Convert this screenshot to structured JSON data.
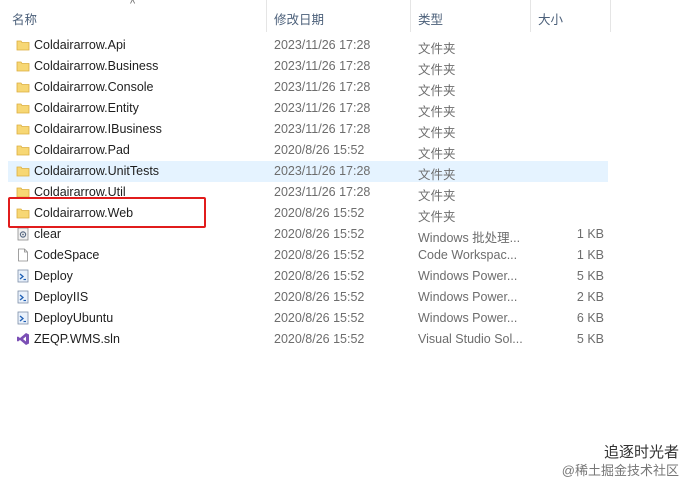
{
  "columns": {
    "name": "名称",
    "date": "修改日期",
    "type": "类型",
    "size": "大小"
  },
  "sort_indicator": "^",
  "files": [
    {
      "name": "Coldairarrow.Api",
      "date": "2023/11/26 17:28",
      "type": "文件夹",
      "size": "",
      "icon": "folder-icon"
    },
    {
      "name": "Coldairarrow.Business",
      "date": "2023/11/26 17:28",
      "type": "文件夹",
      "size": "",
      "icon": "folder-icon"
    },
    {
      "name": "Coldairarrow.Console",
      "date": "2023/11/26 17:28",
      "type": "文件夹",
      "size": "",
      "icon": "folder-icon"
    },
    {
      "name": "Coldairarrow.Entity",
      "date": "2023/11/26 17:28",
      "type": "文件夹",
      "size": "",
      "icon": "folder-icon"
    },
    {
      "name": "Coldairarrow.IBusiness",
      "date": "2023/11/26 17:28",
      "type": "文件夹",
      "size": "",
      "icon": "folder-icon"
    },
    {
      "name": "Coldairarrow.Pad",
      "date": "2020/8/26 15:52",
      "type": "文件夹",
      "size": "",
      "icon": "folder-icon"
    },
    {
      "name": "Coldairarrow.UnitTests",
      "date": "2023/11/26 17:28",
      "type": "文件夹",
      "size": "",
      "icon": "folder-icon"
    },
    {
      "name": "Coldairarrow.Util",
      "date": "2023/11/26 17:28",
      "type": "文件夹",
      "size": "",
      "icon": "folder-icon"
    },
    {
      "name": "Coldairarrow.Web",
      "date": "2020/8/26 15:52",
      "type": "文件夹",
      "size": "",
      "icon": "folder-icon"
    },
    {
      "name": "clear",
      "date": "2020/8/26 15:52",
      "type": "Windows 批处理...",
      "size": "1 KB",
      "icon": "batch-file-icon"
    },
    {
      "name": "CodeSpace",
      "date": "2020/8/26 15:52",
      "type": "Code Workspac...",
      "size": "1 KB",
      "icon": "document-icon"
    },
    {
      "name": "Deploy",
      "date": "2020/8/26 15:52",
      "type": "Windows Power...",
      "size": "5 KB",
      "icon": "powershell-script-icon"
    },
    {
      "name": "DeployIIS",
      "date": "2020/8/26 15:52",
      "type": "Windows Power...",
      "size": "2 KB",
      "icon": "powershell-script-icon"
    },
    {
      "name": "DeployUbuntu",
      "date": "2020/8/26 15:52",
      "type": "Windows Power...",
      "size": "6 KB",
      "icon": "powershell-script-icon"
    },
    {
      "name": "ZEQP.WMS.sln",
      "date": "2020/8/26 15:52",
      "type": "Visual Studio Sol...",
      "size": "5 KB",
      "icon": "visual-studio-solution-icon"
    }
  ],
  "hover_row_index": 6,
  "highlighted_row_index": 8,
  "watermark": {
    "line1": "追逐时光者",
    "line2": "@稀土掘金技术社区"
  },
  "colors": {
    "hover": "#e5f3ff",
    "highlight": "#e11c1c",
    "folder": "#f7d774"
  }
}
